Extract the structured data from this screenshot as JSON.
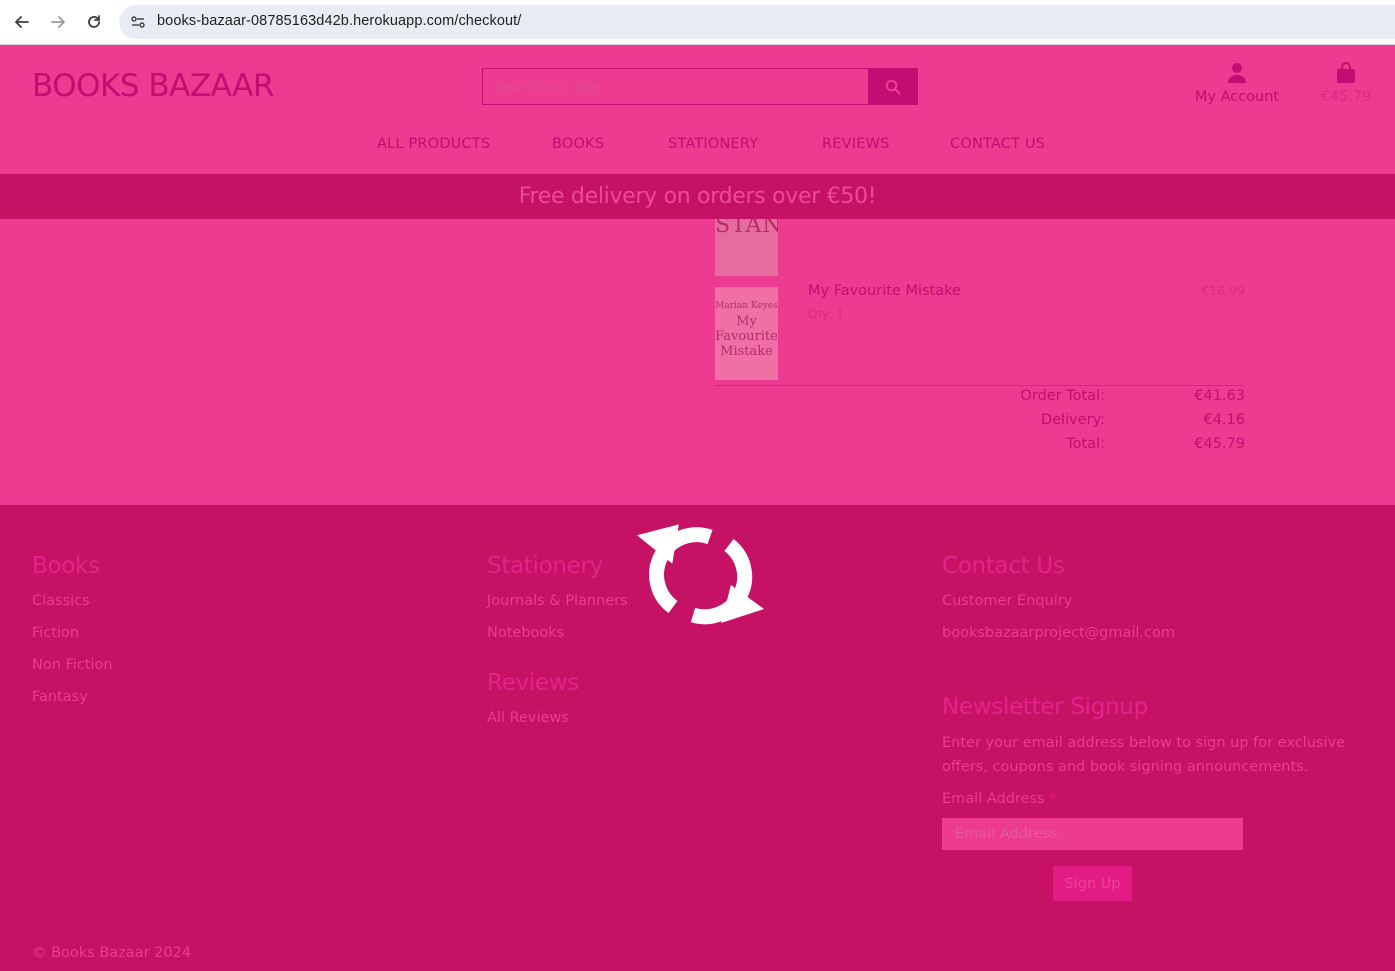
{
  "browser": {
    "url": "books-bazaar-08785163d42b.herokuapp.com/checkout/"
  },
  "header": {
    "logo": "BOOKS BAZAAR",
    "search_placeholder": "Search our site",
    "account_label": "My Account",
    "bag_total": "€45.79"
  },
  "nav": {
    "items": [
      "ALL PRODUCTS",
      "BOOKS",
      "STATIONERY",
      "REVIEWS",
      "CONTACT US"
    ]
  },
  "promo": {
    "text": "Free delivery on orders over €50!"
  },
  "order": {
    "items": [
      {
        "cover_text": "STAND"
      },
      {
        "title": "My Favourite Mistake",
        "qty": "Qty: 1",
        "price": "€16.99",
        "cover_author": "Marian Keyes",
        "cover_title_1": "My",
        "cover_title_2": "Favourite",
        "cover_title_3": "Mistake"
      }
    ],
    "order_total_label": "Order Total:",
    "order_total": "€41.63",
    "delivery_label": "Delivery:",
    "delivery": "€4.16",
    "grand_total_label": "Total:",
    "grand_total": "€45.79"
  },
  "footer": {
    "books": {
      "heading": "Books",
      "links": [
        "Classics",
        "Fiction",
        "Non Fiction",
        "Fantasy"
      ]
    },
    "stationery": {
      "heading": "Stationery",
      "links": [
        "Journals & Planners",
        "Notebooks"
      ]
    },
    "reviews": {
      "heading": "Reviews",
      "links": [
        "All Reviews"
      ]
    },
    "contact": {
      "heading": "Contact Us",
      "links": [
        "Customer Enquiry",
        "booksbazaarproject@gmail.com"
      ]
    },
    "newsletter": {
      "heading": "Newsletter Signup",
      "text_line_1": "Enter your email address below to sign up for exclusive",
      "text_line_2": "offers, coupons and book signing announcements.",
      "email_label": "Email Address",
      "required_mark": "*",
      "email_placeholder": "Email Address",
      "button": "Sign Up"
    },
    "copyright": "© Books Bazaar 2024"
  },
  "overlay": {
    "icon": "refresh-spinner-icon",
    "color": "#ffffff"
  }
}
